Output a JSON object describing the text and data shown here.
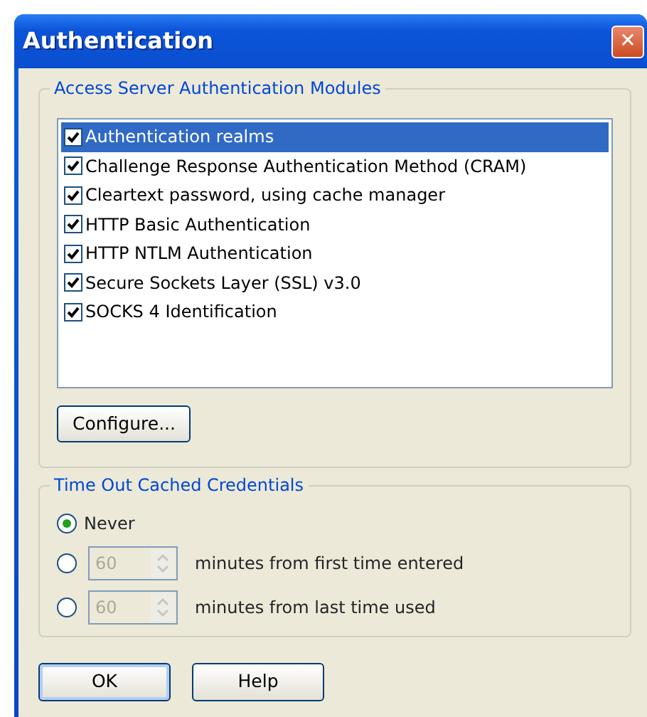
{
  "window": {
    "title": "Authentication",
    "close": "✕"
  },
  "modules_group": {
    "title": "Access Server Authentication Modules",
    "modules": [
      {
        "label": "Authentication realms",
        "checked": true,
        "selected": true
      },
      {
        "label": "Challenge Response Authentication Method (CRAM)",
        "checked": true,
        "selected": false
      },
      {
        "label": "Cleartext password, using cache manager",
        "checked": true,
        "selected": false
      },
      {
        "label": "HTTP Basic Authentication",
        "checked": true,
        "selected": false
      },
      {
        "label": "HTTP NTLM Authentication",
        "checked": true,
        "selected": false
      },
      {
        "label": "Secure Sockets Layer (SSL) v3.0",
        "checked": true,
        "selected": false
      },
      {
        "label": "SOCKS 4 Identification",
        "checked": true,
        "selected": false
      }
    ],
    "button": "Configure..."
  },
  "timeout_group": {
    "title": "Time Out Cached Credentials",
    "options": [
      {
        "kind": "plain",
        "label": "Never",
        "selected": true
      },
      {
        "kind": "spinner",
        "value": "60",
        "disabled": true,
        "suffix": "minutes from first time entered",
        "selected": false
      },
      {
        "kind": "spinner",
        "value": "60",
        "disabled": true,
        "suffix": "minutes from last time used",
        "selected": false
      }
    ]
  },
  "buttons": [
    "OK",
    "Help"
  ]
}
